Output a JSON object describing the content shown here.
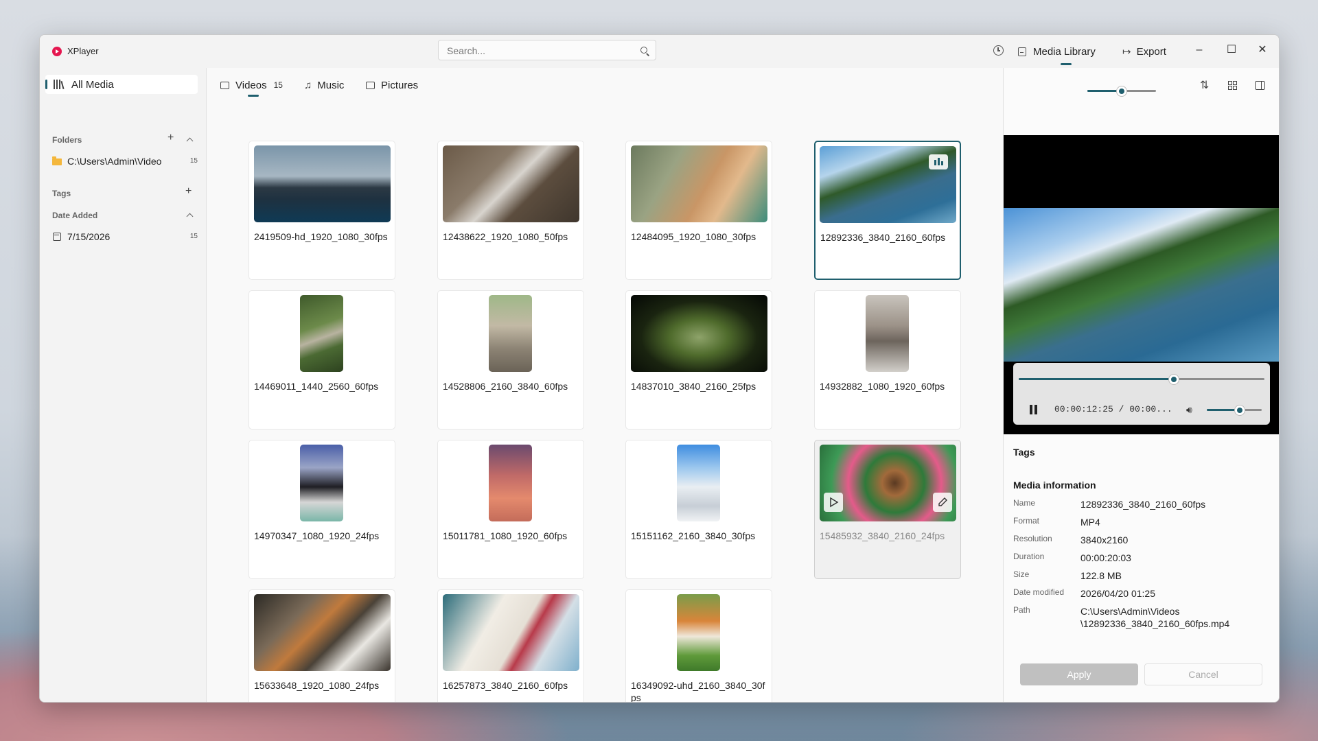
{
  "app": {
    "title": "XPlayer"
  },
  "search": {
    "placeholder": "Search..."
  },
  "toolbar": {
    "media_library": "Media Library",
    "export": "Export"
  },
  "sidebar": {
    "all_media": "All Media",
    "folders_header": "Folders",
    "folders": [
      {
        "label": "C:\\Users\\Admin\\Video",
        "count": "15"
      }
    ],
    "tags_header": "Tags",
    "date_header": "Date Added",
    "dates": [
      {
        "label": "7/15/2026",
        "count": "15"
      }
    ]
  },
  "tabs": [
    {
      "label": "Videos",
      "count": "15"
    },
    {
      "label": "Music"
    },
    {
      "label": "Pictures"
    }
  ],
  "zoom": {
    "level": 0.5
  },
  "media": [
    {
      "name": "2419509-hd_1920_1080_30fps"
    },
    {
      "name": "12438622_1920_1080_50fps"
    },
    {
      "name": "12484095_1920_1080_30fps"
    },
    {
      "name": "12892336_3840_2160_60fps",
      "selected": true
    },
    {
      "name": "14469011_1440_2560_60fps"
    },
    {
      "name": "14528806_2160_3840_60fps"
    },
    {
      "name": "14837010_3840_2160_25fps"
    },
    {
      "name": "14932882_1080_1920_60fps"
    },
    {
      "name": "14970347_1080_1920_24fps"
    },
    {
      "name": "15011781_1080_1920_60fps"
    },
    {
      "name": "15151162_2160_3840_30fps"
    },
    {
      "name": "15485932_3840_2160_24fps",
      "hover": true
    },
    {
      "name": "15633648_1920_1080_24fps"
    },
    {
      "name": "16257873_3840_2160_60fps"
    },
    {
      "name": "16349092-uhd_2160_3840_30fps"
    }
  ],
  "player": {
    "time": "00:00:12:25 / 00:00...",
    "progress": 0.63,
    "volume": 0.6
  },
  "details": {
    "tags_heading": "Tags",
    "info_heading": "Media information",
    "fields": [
      {
        "key": "Name",
        "value": "12892336_3840_2160_60fps"
      },
      {
        "key": "Format",
        "value": "MP4"
      },
      {
        "key": "Resolution",
        "value": "3840x2160"
      },
      {
        "key": "Duration",
        "value": "00:00:20:03"
      },
      {
        "key": "Size",
        "value": "122.8 MB"
      },
      {
        "key": "Date modified",
        "value": "2026/04/20 01:25"
      },
      {
        "key": "Path",
        "value": "C:\\Users\\Admin\\Videos\n\\12892336_3840_2160_60fps.mp4"
      }
    ],
    "apply_label": "Apply",
    "cancel_label": "Cancel"
  },
  "colors": {
    "accent": "#1f5f6e",
    "logo": "#e5164f"
  }
}
